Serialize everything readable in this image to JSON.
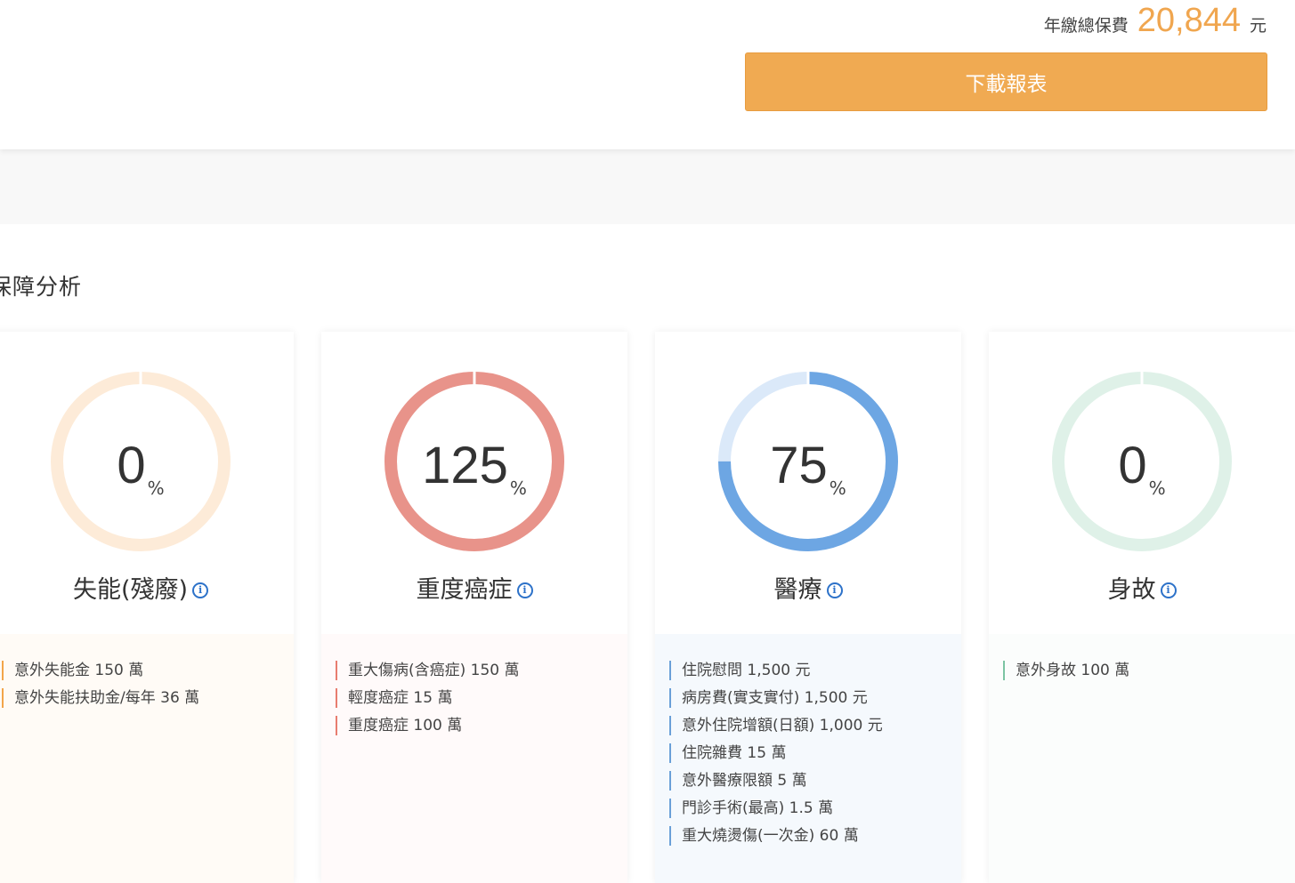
{
  "header": {
    "total_label": "年繳總保費",
    "total_value": "20,844",
    "total_unit": "元",
    "download_label": "下載報表"
  },
  "section_title": "保障分析",
  "colors": {
    "accent": "#f0aa52",
    "info_icon": "#2d72c9"
  },
  "cards": [
    {
      "percent": "0",
      "percent_sign": "%",
      "percent_value": 0,
      "title": "失能(殘廢)",
      "ring_color": "#f5c99a",
      "track_color": "#fdebd8",
      "bottom_bg": "#fffbf6",
      "bar_color": "#f2a54a",
      "items": [
        "意外失能金 150 萬",
        "意外失能扶助金/每年 36 萬"
      ]
    },
    {
      "percent": "125",
      "percent_sign": "%",
      "percent_value": 125,
      "title": "重度癌症",
      "ring_color": "#e8938a",
      "track_color": "#f8dcd8",
      "bottom_bg": "#fffafa",
      "bar_color": "#e87d70",
      "items": [
        "重大傷病(含癌症) 150 萬",
        "輕度癌症 15 萬",
        "重度癌症 100 萬"
      ]
    },
    {
      "percent": "75",
      "percent_sign": "%",
      "percent_value": 75,
      "title": "醫療",
      "ring_color": "#6da6e3",
      "track_color": "#dbe9f9",
      "bottom_bg": "#f5f9fd",
      "bar_color": "#6aa0d8",
      "items": [
        "住院慰問 1,500 元",
        "病房費(實支實付) 1,500 元",
        "意外住院增額(日額) 1,000 元",
        "住院雜費 15 萬",
        "意外醫療限額 5 萬",
        "門診手術(最高) 1.5 萬",
        "重大燒燙傷(一次金) 60 萬"
      ]
    },
    {
      "percent": "0",
      "percent_sign": "%",
      "percent_value": 0,
      "title": "身故",
      "ring_color": "#9fd5bd",
      "track_color": "#dff1e8",
      "bottom_bg": "#fbfdfc",
      "bar_color": "#7cc4a3",
      "items": [
        "意外身故 100 萬"
      ]
    }
  ]
}
